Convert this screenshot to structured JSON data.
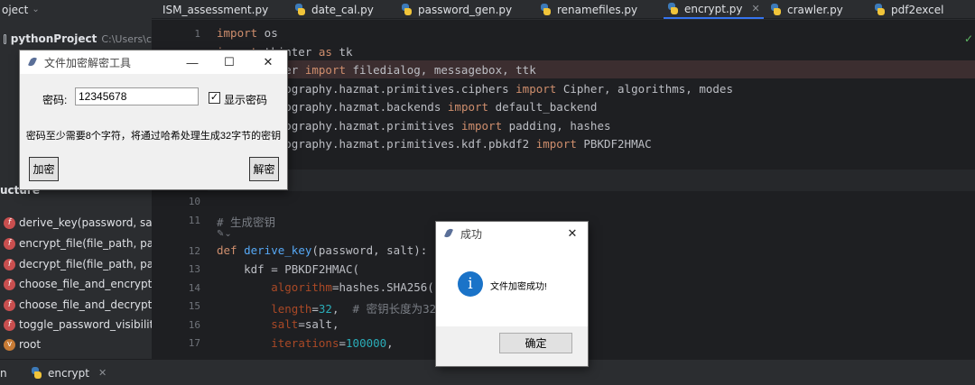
{
  "project": {
    "header": "oject",
    "root_name": "pythonProject",
    "root_path": "C:\\Users\\c"
  },
  "tabs": [
    {
      "label": "ISM_assessment.py"
    },
    {
      "label": "date_cal.py"
    },
    {
      "label": "password_gen.py"
    },
    {
      "label": "renamefiles.py"
    },
    {
      "label": "encrypt.py"
    },
    {
      "label": "crawler.py"
    },
    {
      "label": "pdf2excel"
    }
  ],
  "structure": {
    "header": "ucture",
    "items": [
      {
        "label": "derive_key(password, salt)"
      },
      {
        "label": "encrypt_file(file_path, passw"
      },
      {
        "label": "decrypt_file(file_path, passw"
      },
      {
        "label": "choose_file_and_encrypt()"
      },
      {
        "label": "choose_file_and_decrypt()"
      },
      {
        "label": "toggle_password_visibility("
      },
      {
        "label": "root"
      }
    ]
  },
  "editor": {
    "line_numbers": [
      "1",
      "10",
      "11",
      "12",
      "13",
      "14",
      "15",
      "16",
      "17"
    ]
  },
  "status": {
    "left": "n",
    "run_label": "encrypt"
  },
  "encrypt_window": {
    "title": "文件加密解密工具",
    "password_label": "密码:",
    "password_value": "12345678",
    "show_password_label": "显示密码",
    "hint": "密码至少需要8个字符，将通过哈希处理生成32字节的密钥",
    "encrypt_label": "加密",
    "decrypt_label": "解密"
  },
  "success_window": {
    "title": "成功",
    "message": "文件加密成功!",
    "ok_label": "确定"
  }
}
